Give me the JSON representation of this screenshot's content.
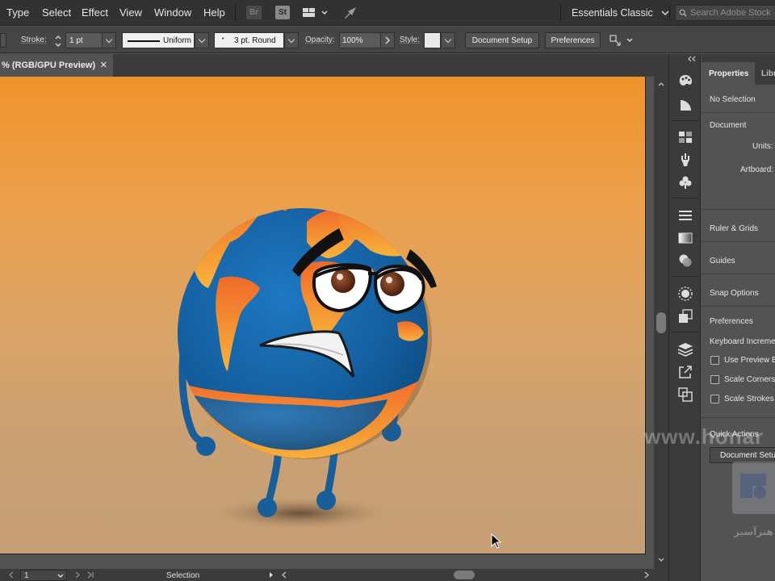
{
  "menubar": {
    "items": [
      "Type",
      "Select",
      "Effect",
      "View",
      "Window",
      "Help"
    ],
    "bridge_label": "Br",
    "stock_label": "St",
    "workspace": "Essentials Classic",
    "search_placeholder": "Search Adobe Stock"
  },
  "controlbar": {
    "stroke_label": "Stroke:",
    "stroke_weight": "1 pt",
    "variable_width_profile": "Uniform",
    "brush_definition": "3 pt. Round",
    "opacity_label": "Opacity:",
    "opacity_value": "100%",
    "style_label": "Style:",
    "document_setup": "Document Setup",
    "preferences": "Preferences"
  },
  "document": {
    "tab_title": "% (RGB/GPU Preview)",
    "close_glyph": "✕"
  },
  "statusbar": {
    "artboard_number": "1",
    "status_text": "Selection"
  },
  "panel": {
    "tabs": [
      "Properties",
      "Libr"
    ],
    "no_selection": "No Selection",
    "document_heading": "Document",
    "units_label": "Units:",
    "artboard_label": "Artboard:",
    "ruler_grids": "Ruler & Grids",
    "guides": "Guides",
    "snap_options": "Snap Options",
    "preferences_heading": "Preferences",
    "keyboard_increment": "Keyboard Increme",
    "checkboxes": [
      {
        "label": "Use Preview B",
        "checked": false
      },
      {
        "label": "Scale Corners",
        "checked": false
      },
      {
        "label": "Scale Strokes &",
        "checked": false
      }
    ],
    "quick_actions": "Quick Actions",
    "document_setup_button": "Document Setu"
  },
  "watermark": {
    "url_text": "www.honar",
    "logo_text": "هنرآسیز"
  },
  "colors": {
    "accent_blue": "#1565a6",
    "land_orange": "#f39a3a",
    "ui_dark": "#323232",
    "ui_mid": "#535353"
  },
  "icons": [
    "brush-icon",
    "search-icon",
    "chevron-down-icon",
    "close-icon",
    "layers-icon",
    "cursor-icon"
  ]
}
